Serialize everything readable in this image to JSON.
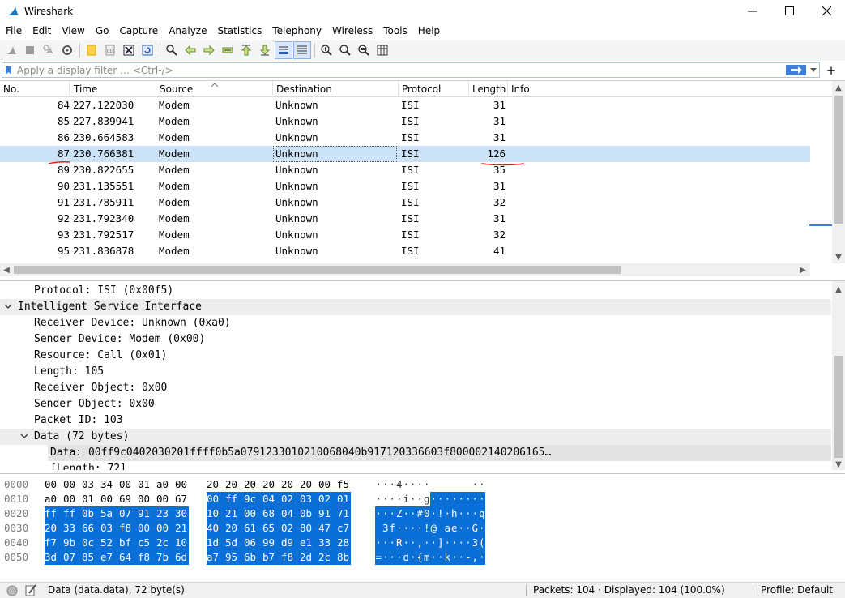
{
  "window": {
    "title": "Wireshark"
  },
  "menu": [
    "File",
    "Edit",
    "View",
    "Go",
    "Capture",
    "Analyze",
    "Statistics",
    "Telephony",
    "Wireless",
    "Tools",
    "Help"
  ],
  "filter": {
    "placeholder": "Apply a display filter … <Ctrl-/>"
  },
  "packet_list": {
    "columns": [
      "No.",
      "Time",
      "Source",
      "Destination",
      "Protocol",
      "Length",
      "Info"
    ],
    "rows": [
      {
        "no": "84",
        "time": "227.122030",
        "source": "Modem",
        "destination": "Unknown",
        "protocol": "ISI",
        "length": "31",
        "info": ""
      },
      {
        "no": "85",
        "time": "227.839941",
        "source": "Modem",
        "destination": "Unknown",
        "protocol": "ISI",
        "length": "31",
        "info": ""
      },
      {
        "no": "86",
        "time": "230.664583",
        "source": "Modem",
        "destination": "Unknown",
        "protocol": "ISI",
        "length": "31",
        "info": ""
      },
      {
        "no": "87",
        "time": "230.766381",
        "source": "Modem",
        "destination": "Unknown",
        "protocol": "ISI",
        "length": "126",
        "info": "",
        "selected": true
      },
      {
        "no": "89",
        "time": "230.822655",
        "source": "Modem",
        "destination": "Unknown",
        "protocol": "ISI",
        "length": "35",
        "info": ""
      },
      {
        "no": "90",
        "time": "231.135551",
        "source": "Modem",
        "destination": "Unknown",
        "protocol": "ISI",
        "length": "31",
        "info": ""
      },
      {
        "no": "91",
        "time": "231.785911",
        "source": "Modem",
        "destination": "Unknown",
        "protocol": "ISI",
        "length": "32",
        "info": ""
      },
      {
        "no": "92",
        "time": "231.792340",
        "source": "Modem",
        "destination": "Unknown",
        "protocol": "ISI",
        "length": "31",
        "info": ""
      },
      {
        "no": "93",
        "time": "231.792517",
        "source": "Modem",
        "destination": "Unknown",
        "protocol": "ISI",
        "length": "32",
        "info": ""
      },
      {
        "no": "95",
        "time": "231.836878",
        "source": "Modem",
        "destination": "Unknown",
        "protocol": "ISI",
        "length": "41",
        "info": ""
      }
    ]
  },
  "details": [
    {
      "text": "Protocol: ISI (0x00f5)",
      "indent": 1,
      "caret": ""
    },
    {
      "text": "Intelligent Service Interface",
      "indent": 0,
      "caret": "open",
      "hover": true
    },
    {
      "text": "Receiver Device: Unknown (0xa0)",
      "indent": 1,
      "caret": ""
    },
    {
      "text": "Sender Device: Modem (0x00)",
      "indent": 1,
      "caret": ""
    },
    {
      "text": "Resource: Call (0x01)",
      "indent": 1,
      "caret": ""
    },
    {
      "text": "Length: 105",
      "indent": 1,
      "caret": ""
    },
    {
      "text": "Receiver Object: 0x00",
      "indent": 1,
      "caret": ""
    },
    {
      "text": "Sender Object: 0x00",
      "indent": 1,
      "caret": ""
    },
    {
      "text": "Packet ID: 103",
      "indent": 1,
      "caret": ""
    },
    {
      "text": "Data (72 bytes)",
      "indent": 1,
      "caret": "open",
      "hover": true
    },
    {
      "text": "Data: 00ff9c0402030201ffff0b5a0791233010210068040b917120336603f800002140206165…",
      "indent": 2,
      "caret": "",
      "selected": true
    },
    {
      "text": "[Length: 72]",
      "indent": 2,
      "caret": ""
    }
  ],
  "bytes": {
    "highlight_start": 24,
    "lines": [
      {
        "offset": "0000",
        "hex": [
          "00",
          "00",
          "03",
          "34",
          "00",
          "01",
          "a0",
          "00",
          "20",
          "20",
          "20",
          "20",
          "20",
          "20",
          "00",
          "f5"
        ],
        "ascii": [
          "·",
          "·",
          "·",
          "4",
          "·",
          "·",
          "·",
          "·",
          " ",
          " ",
          " ",
          " ",
          " ",
          " ",
          "·",
          "·"
        ]
      },
      {
        "offset": "0010",
        "hex": [
          "a0",
          "00",
          "01",
          "00",
          "69",
          "00",
          "00",
          "67",
          "00",
          "ff",
          "9c",
          "04",
          "02",
          "03",
          "02",
          "01"
        ],
        "ascii": [
          "·",
          "·",
          "·",
          "·",
          "i",
          "·",
          "·",
          "g",
          "·",
          "·",
          "·",
          "·",
          "·",
          "·",
          "·",
          "·"
        ]
      },
      {
        "offset": "0020",
        "hex": [
          "ff",
          "ff",
          "0b",
          "5a",
          "07",
          "91",
          "23",
          "30",
          "10",
          "21",
          "00",
          "68",
          "04",
          "0b",
          "91",
          "71"
        ],
        "ascii": [
          "·",
          "·",
          "·",
          "Z",
          "·",
          "·",
          "#",
          "0",
          "·",
          "!",
          "·",
          "h",
          "·",
          "·",
          "·",
          "q"
        ]
      },
      {
        "offset": "0030",
        "hex": [
          "20",
          "33",
          "66",
          "03",
          "f8",
          "00",
          "00",
          "21",
          "40",
          "20",
          "61",
          "65",
          "02",
          "80",
          "47",
          "c7"
        ],
        "ascii": [
          " ",
          "3",
          "f",
          "·",
          "·",
          "·",
          "·",
          "!",
          "@",
          " ",
          "a",
          "e",
          "·",
          "·",
          "G",
          "·"
        ]
      },
      {
        "offset": "0040",
        "hex": [
          "f7",
          "9b",
          "0c",
          "52",
          "bf",
          "c5",
          "2c",
          "10",
          "1d",
          "5d",
          "06",
          "99",
          "d9",
          "e1",
          "33",
          "28"
        ],
        "ascii": [
          "·",
          "·",
          "·",
          "R",
          "·",
          "·",
          ",",
          "·",
          "·",
          "]",
          "·",
          "·",
          "·",
          "·",
          "3",
          "("
        ]
      },
      {
        "offset": "0050",
        "hex": [
          "3d",
          "07",
          "85",
          "e7",
          "64",
          "f8",
          "7b",
          "6d",
          "a7",
          "95",
          "6b",
          "b7",
          "f8",
          "2d",
          "2c",
          "8b"
        ],
        "ascii": [
          "=",
          "·",
          "·",
          "·",
          "d",
          "·",
          "{",
          "m",
          "·",
          "·",
          "k",
          "·",
          "·",
          "-",
          ",",
          "·"
        ]
      }
    ]
  },
  "status": {
    "left": "Data (data.data), 72 byte(s)",
    "packets": "Packets: 104 · Displayed: 104 (100.0%)",
    "profile": "Profile: Default"
  },
  "colors": {
    "selection": "#cce3f7",
    "byte_highlight": "#0a6fd6",
    "annotation": "#e02020",
    "filter_apply": "#3d7fd8"
  }
}
